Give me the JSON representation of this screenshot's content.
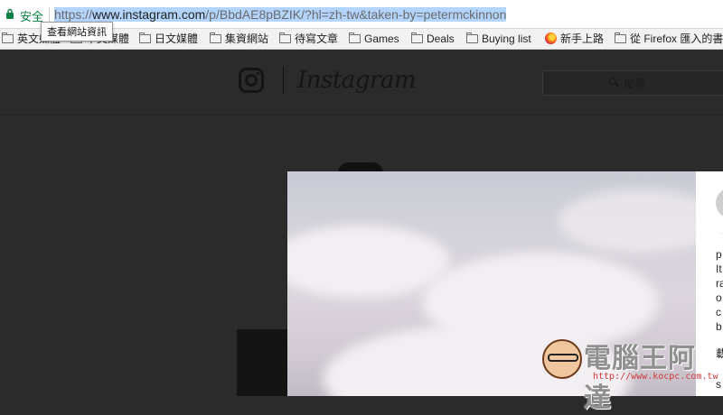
{
  "address_bar": {
    "security_label": "安全",
    "url_scheme": "https://",
    "url_host": "www.instagram.com",
    "url_path": "/p/BbdAE8pBZIK/?hl=zh-tw&taken-by=petermckinnon",
    "tooltip": "查看網站資訊"
  },
  "bookmarks": [
    {
      "label": "英文媒體",
      "icon": "folder-icon"
    },
    {
      "label": "中文媒體",
      "icon": "folder-icon"
    },
    {
      "label": "日文媒體",
      "icon": "folder-icon"
    },
    {
      "label": "集資網站",
      "icon": "folder-icon"
    },
    {
      "label": "待寫文章",
      "icon": "folder-icon"
    },
    {
      "label": "Games",
      "icon": "folder-icon"
    },
    {
      "label": "Deals",
      "icon": "folder-icon"
    },
    {
      "label": "Buying list",
      "icon": "folder-icon"
    },
    {
      "label": "新手上路",
      "icon": "firefox-icon"
    },
    {
      "label": "從 Firefox 匯入的書",
      "icon": "folder-icon"
    }
  ],
  "instagram": {
    "wordmark": "Instagram",
    "search_placeholder": "搜尋"
  },
  "modal": {
    "side_text": [
      "p",
      "It",
      "ra",
      "o",
      "c",
      "b",
      "載",
      "s"
    ]
  },
  "watermark": {
    "title": "電腦王阿達",
    "url": "http://www.kocpc.com.tw"
  },
  "colors": {
    "backdrop": "#2b2b2b",
    "secure_green": "#0b8043",
    "selection": "#b3d4fc"
  }
}
